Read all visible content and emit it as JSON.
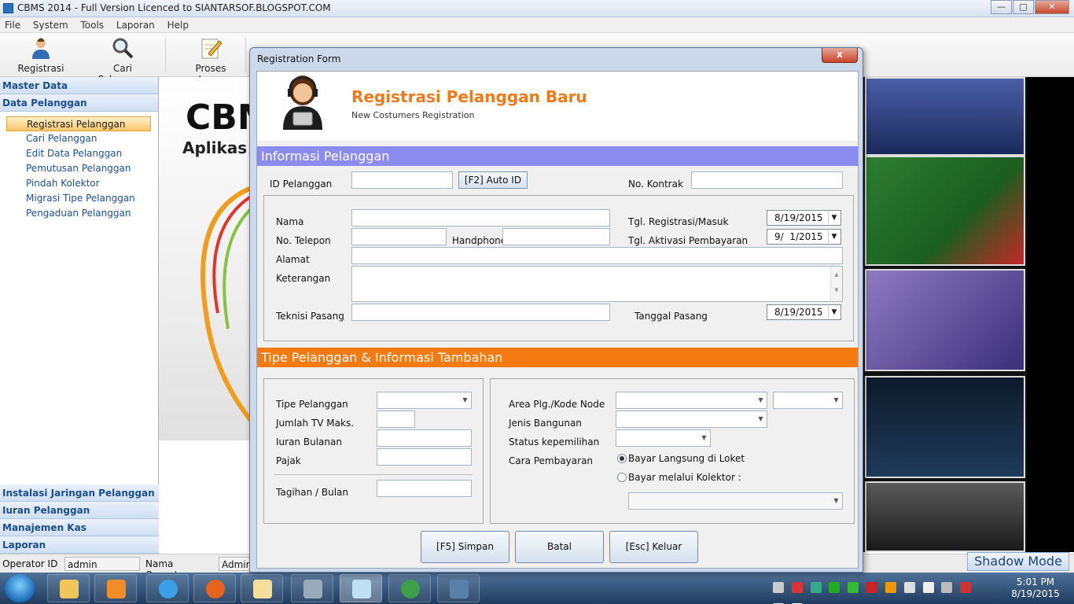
{
  "window": {
    "title": "CBMS 2014 - Full Version  Licenced to SIANTARSOF.BLOGSPOT.COM"
  },
  "menu": [
    "File",
    "System",
    "Tools",
    "Laporan",
    "Help"
  ],
  "toolbar": {
    "registrasi": "Registrasi",
    "cari_pelanggan": "Cari Pelanggan",
    "proses_iuran": "Proses Iuran"
  },
  "sidebar": {
    "master_data": "Master Data",
    "data_pelanggan": "Data Pelanggan",
    "items": [
      "Registrasi Pelanggan",
      "Cari Pelanggan",
      "Edit Data Pelanggan",
      "Pemutusan Pelanggan",
      "Pindah Kolektor",
      "Migrasi Tipe Pelanggan",
      "Pengaduan Pelanggan"
    ],
    "bottom": [
      "Instalasi Jaringan Pelanggan",
      "Iuran Pelanggan",
      "Manajemen Kas",
      "Laporan"
    ]
  },
  "splash": {
    "big": "CBM",
    "small": "Aplikas"
  },
  "status": {
    "operator_id_label": "Operator ID :",
    "operator_id": "admin",
    "operator_name_label": "Nama Operator :",
    "operator_name": "Admin",
    "shadow_mode": "Shadow Mode"
  },
  "clock": {
    "time": "5:01 PM",
    "date": "8/19/2015"
  },
  "dialog": {
    "title": "Registration Form",
    "close": "x",
    "header_title": "Registrasi Pelanggan Baru",
    "header_sub": "New Costumers Registration",
    "section1": "Informasi Pelanggan",
    "section2": "Tipe Pelanggan & Informasi Tambahan",
    "id_pelanggan": "ID Pelanggan",
    "auto_id": "[F2] Auto ID",
    "no_kontrak": "No. Kontrak",
    "nama": "Nama",
    "no_telepon": "No. Telepon",
    "handphone": "Handphone",
    "alamat": "Alamat",
    "keterangan": "Keterangan",
    "teknisi_pasang": "Teknisi Pasang",
    "tgl_registrasi": "Tgl. Registrasi/Masuk",
    "tgl_registrasi_val": "8/19/2015",
    "tgl_aktivasi": "Tgl. Aktivasi Pembayaran",
    "tgl_aktivasi_val": "9/  1/2015",
    "tanggal_pasang": "Tanggal Pasang",
    "tanggal_pasang_val": "8/19/2015",
    "tipe_pelanggan": "Tipe Pelanggan",
    "jumlah_tv": "Jumlah TV Maks.",
    "iuran_bulanan": "Iuran Bulanan",
    "pajak": "Pajak",
    "tagihan": "Tagihan / Bulan",
    "area": "Area Plg./Kode Node",
    "jenis_bangunan": "Jenis Bangunan",
    "status_kepemilihan": "Status kepemilihan",
    "cara_pembayaran": "Cara Pembayaran",
    "bayar_loket": "Bayar Langsung di Loket",
    "bayar_kolektor": "Bayar melalui Kolektor :",
    "simpan": "[F5] Simpan",
    "batal": "Batal",
    "keluar": "[Esc] Keluar"
  },
  "colors": {
    "accent_orange": "#f57a12",
    "section_blue": "#8c8cf0",
    "title_orange": "#f07a1a"
  }
}
